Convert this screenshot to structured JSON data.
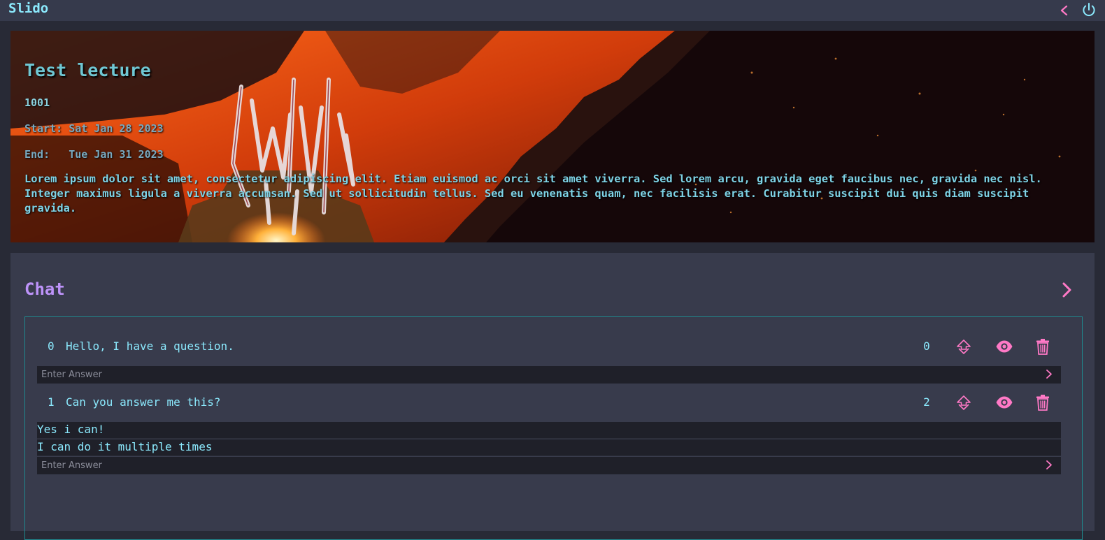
{
  "app": {
    "title": "Slido"
  },
  "header": {
    "back_icon": "chevron-left-icon",
    "power_icon": "power-icon"
  },
  "lecture": {
    "title": "Test lecture",
    "id": "1001",
    "start_label": "Start:",
    "start_date": "Sat Jan 28 2023",
    "end_label": "End:",
    "end_date": "Tue Jan 31 2023",
    "start_line": "Start: Sat Jan 28 2023",
    "end_line": "End:   Tue Jan 31 2023",
    "description": "Lorem ipsum dolor sit amet, consectetur adipiscing elit. Etiam euismod ac orci sit amet viverra. Sed lorem arcu, gravida eget faucibus nec, gravida nec nisl. Integer maximus ligula a viverra accumsan. Sed ut sollicitudin tellus. Sed eu venenatis quam, nec facilisis erat. Curabitur suscipit dui quis diam suscipit gravida."
  },
  "chat": {
    "title": "Chat",
    "answer_placeholder": "Enter Answer",
    "questions": [
      {
        "index": "0",
        "text": "Hello, I have a question.",
        "votes": "0",
        "answers": []
      },
      {
        "index": "1",
        "text": "Can you answer me this?",
        "votes": "2",
        "answers": [
          "Yes i can!",
          "I can do it multiple times"
        ]
      }
    ]
  },
  "colors": {
    "background": "#282a36",
    "topbar": "#363a4c",
    "panel": "#383b4c",
    "cyan": "#8be9fd",
    "purple": "#bd93f9",
    "pink": "#ff79c6",
    "teal_border": "#1f8a8f"
  }
}
